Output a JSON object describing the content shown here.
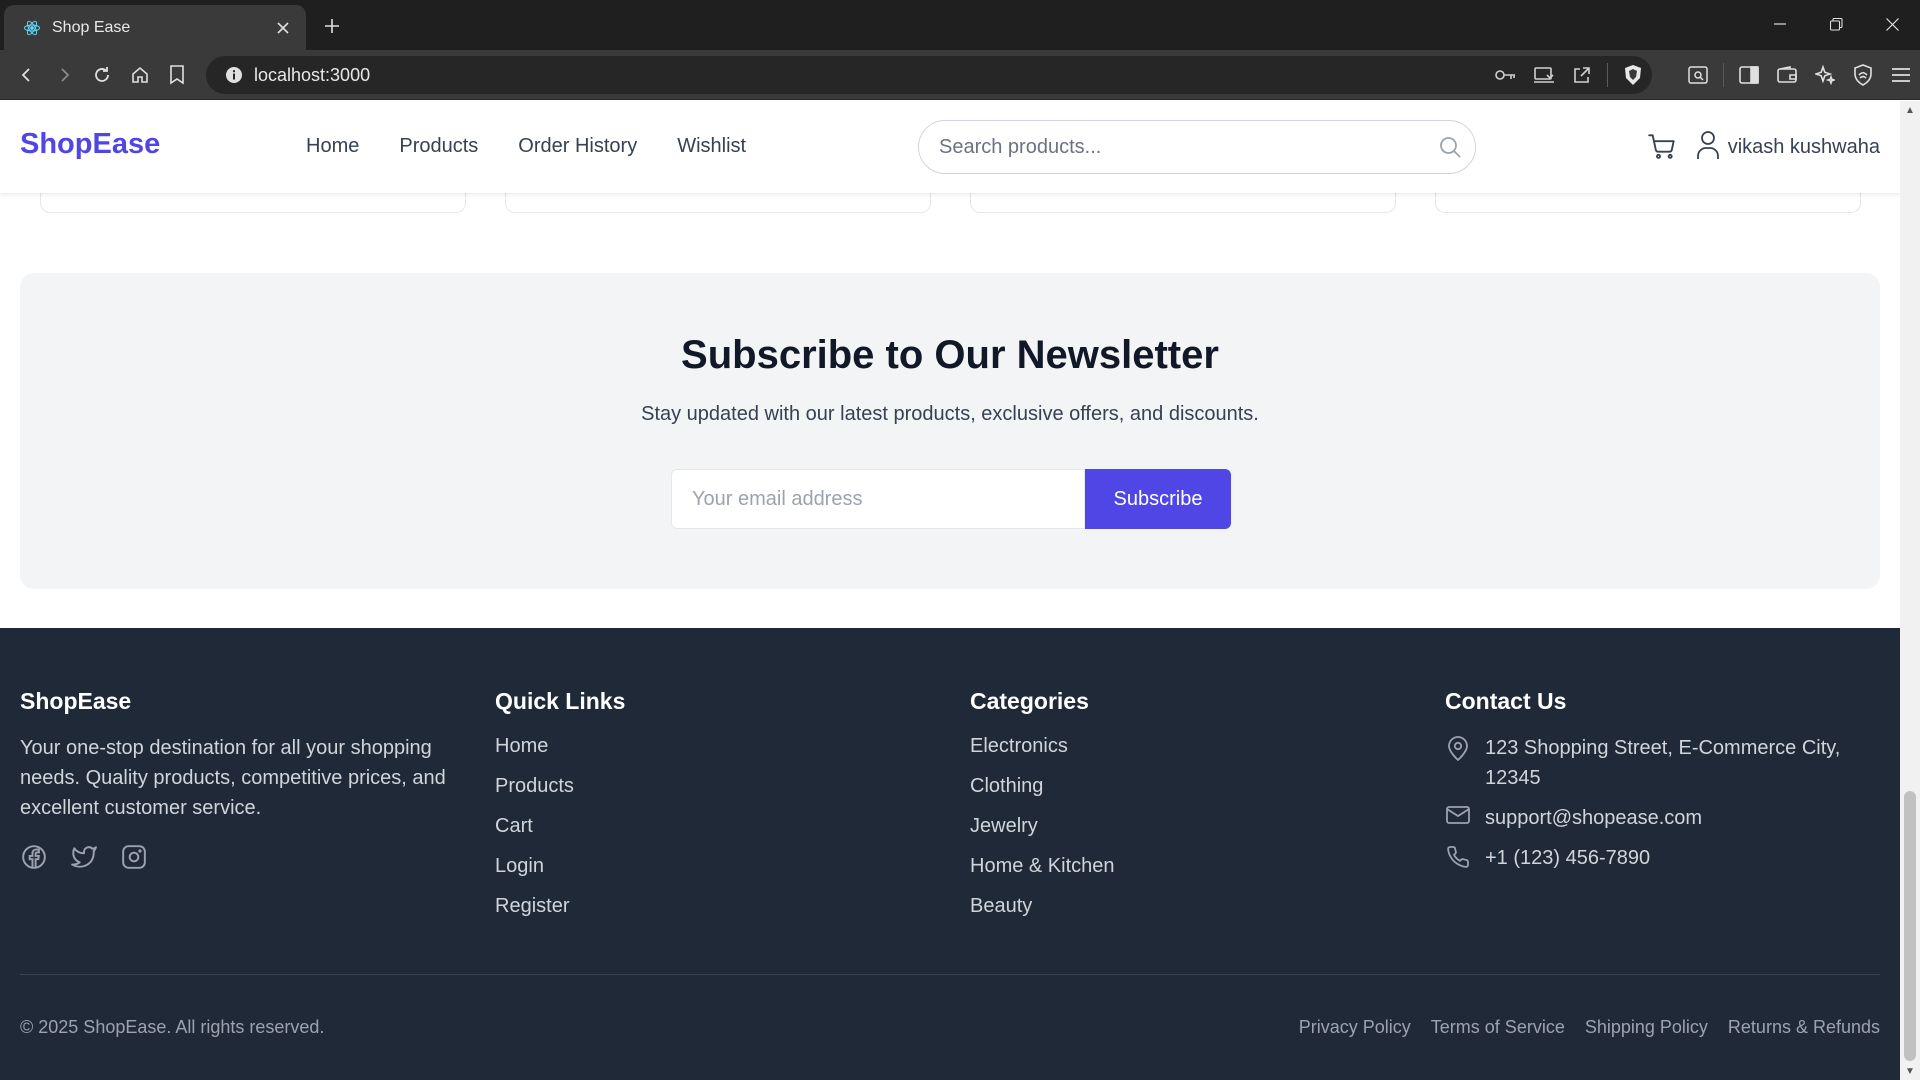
{
  "browser": {
    "tab_title": "Shop Ease",
    "url": "localhost:3000"
  },
  "nav": {
    "logo": "ShopEase",
    "links": [
      "Home",
      "Products",
      "Order History",
      "Wishlist"
    ],
    "search_placeholder": "Search products...",
    "user_name": "vikash kushwaha"
  },
  "newsletter": {
    "title": "Subscribe to Our Newsletter",
    "subtitle": "Stay updated with our latest products, exclusive offers, and discounts.",
    "email_placeholder": "Your email address",
    "button_label": "Subscribe"
  },
  "footer": {
    "brand": "ShopEase",
    "about": "Your one-stop destination for all your shopping needs. Quality products, competitive prices, and excellent customer service.",
    "quick_links_heading": "Quick Links",
    "quick_links": [
      "Home",
      "Products",
      "Cart",
      "Login",
      "Register"
    ],
    "categories_heading": "Categories",
    "categories": [
      "Electronics",
      "Clothing",
      "Jewelry",
      "Home & Kitchen",
      "Beauty"
    ],
    "contact_heading": "Contact Us",
    "address": "123 Shopping Street, E-Commerce City, 12345",
    "email": "support@shopease.com",
    "phone": "+1 (123) 456-7890",
    "copyright": "© 2025 ShopEase. All rights reserved.",
    "legal_links": [
      "Privacy Policy",
      "Terms of Service",
      "Shipping Policy",
      "Returns & Refunds"
    ]
  },
  "colors": {
    "brand": "#4f46e5",
    "footer_bg": "#1f2937",
    "newsletter_bg": "#f3f4f6"
  }
}
